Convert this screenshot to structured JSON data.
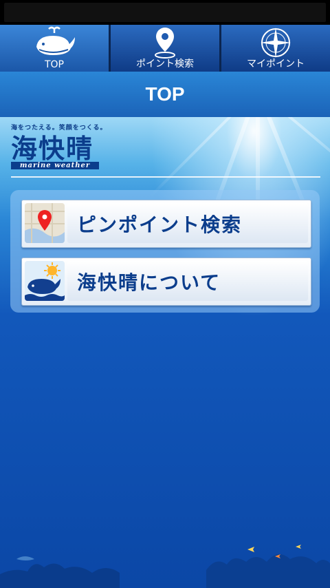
{
  "tabs": [
    {
      "label": "TOP",
      "icon": "whale-icon"
    },
    {
      "label": "ポイント検索",
      "icon": "map-pin-icon"
    },
    {
      "label": "マイポイント",
      "icon": "compass-icon"
    }
  ],
  "header": {
    "title": "TOP"
  },
  "logo": {
    "tagline": "海をつたえる。笑顔をつくる。",
    "mark": "海快晴",
    "subtitle": "marine weather"
  },
  "menu": [
    {
      "label": "ピンポイント検索",
      "icon": "map-pin-icon"
    },
    {
      "label": "海快晴について",
      "icon": "whale-sun-icon"
    }
  ],
  "colors": {
    "brand_navy": "#0b3d8c",
    "tab_gradient_top": "#2b6bc0",
    "background_blue": "#0b47a6"
  }
}
